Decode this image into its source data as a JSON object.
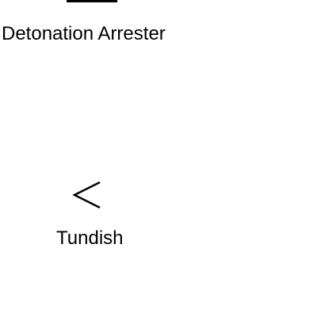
{
  "diagram": {
    "elements": [
      {
        "id": "detonation-arrester",
        "label": "Detonation Arrester",
        "icon": "detonation-arrester-icon"
      },
      {
        "id": "tundish",
        "label": "Tundish",
        "icon": "tundish-icon"
      }
    ],
    "colors": {
      "background": "#ffffff",
      "stroke": "#000000",
      "text": "#000000"
    }
  }
}
